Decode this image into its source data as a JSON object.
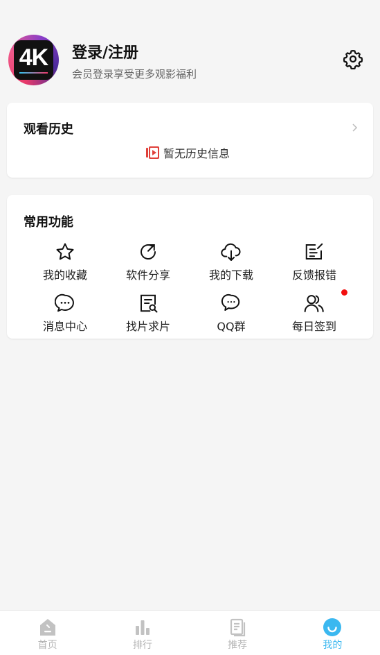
{
  "header": {
    "avatar_text": "4K",
    "title": "登录/注册",
    "subtitle": "会员登录享受更多观影福利",
    "settings_icon": "gear-icon"
  },
  "history": {
    "title": "观看历史",
    "empty_text": "暂无历史信息",
    "more_icon": "chevron-right-icon"
  },
  "functions": {
    "title": "常用功能",
    "items": [
      {
        "label": "我的收藏",
        "icon": "star-icon"
      },
      {
        "label": "软件分享",
        "icon": "share-icon"
      },
      {
        "label": "我的下载",
        "icon": "cloud-download-icon"
      },
      {
        "label": "反馈报错",
        "icon": "edit-icon"
      },
      {
        "label": "消息中心",
        "icon": "message-icon"
      },
      {
        "label": "找片求片",
        "icon": "search-doc-icon"
      },
      {
        "label": "QQ群",
        "icon": "chat-icon"
      },
      {
        "label": "每日签到",
        "icon": "users-icon",
        "badge": true
      }
    ]
  },
  "nav": {
    "items": [
      {
        "label": "首页",
        "icon": "home-icon"
      },
      {
        "label": "排行",
        "icon": "bar-chart-icon"
      },
      {
        "label": "推荐",
        "icon": "document-icon"
      },
      {
        "label": "我的",
        "icon": "profile-icon",
        "active": true
      }
    ],
    "active_color": "#3bb8f0",
    "inactive_color": "#b5b5b5"
  }
}
